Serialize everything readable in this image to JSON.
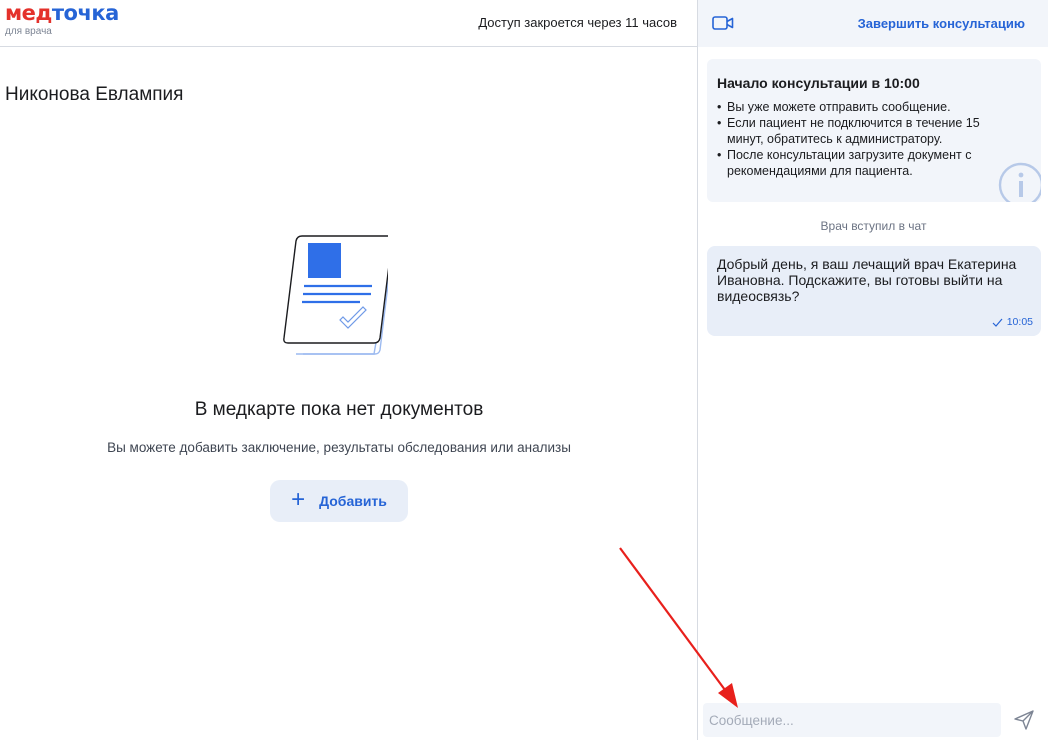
{
  "header": {
    "logo_part1": "мед",
    "logo_part2": "точка",
    "logo_sub": "для врача",
    "access_notice": "Доступ закроется через 11 часов"
  },
  "patient": {
    "name": "Никонова Евлампия"
  },
  "empty_state": {
    "title": "В медкарте пока нет документов",
    "subtitle": "Вы можете добавить заключение, результаты обследования или анализы",
    "add_button_label": "Добавить",
    "add_button_icon": "plus-icon",
    "illustration": "document-icon"
  },
  "chat": {
    "header": {
      "video_icon": "video-camera-icon",
      "end_button_label": "Завершить консультацию"
    },
    "notice": {
      "title": "Начало консультации в 10:00",
      "items": [
        "Вы уже можете отправить сообщение.",
        "Если пациент не подключится в течение 15 минут, обратитесь к администратору.",
        "После консультации загрузите документ с рекомендациями для пациента."
      ],
      "icon": "info-icon"
    },
    "system_message": "Врач вступил в чат",
    "messages": [
      {
        "text": "Добрый день, я ваш лечащий врач Екатерина Ивановна. Подскажите, вы готовы выйти на видеосвязь?",
        "time": "10:05",
        "status_icon": "check-icon"
      }
    ],
    "composer": {
      "placeholder": "Сообщение...",
      "value": "",
      "send_icon": "send-icon"
    }
  },
  "colors": {
    "accent": "#2664d6",
    "logo_red": "#e4312b",
    "panel_bg": "#f2f5fa",
    "bubble_bg": "#e8eef8",
    "annotation_arrow": "#e8201c"
  }
}
